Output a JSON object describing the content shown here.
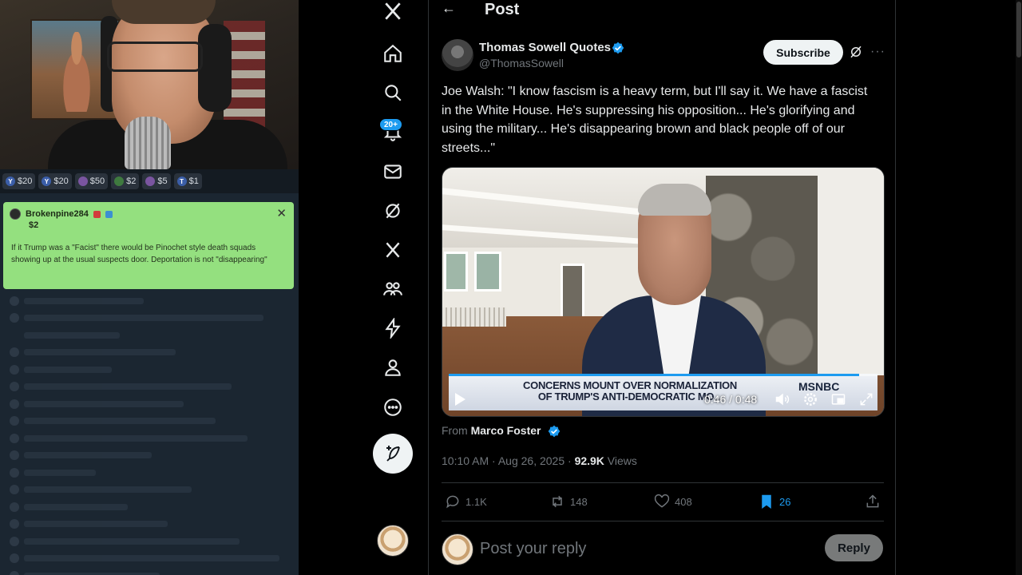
{
  "stream": {
    "tips": [
      {
        "icon": "Y",
        "amount": "$20"
      },
      {
        "icon": "Y",
        "amount": "$20"
      },
      {
        "icon": "",
        "amount": "$50"
      },
      {
        "icon": "",
        "amount": "$2"
      },
      {
        "icon": "",
        "amount": "$5"
      },
      {
        "icon": "T",
        "amount": "$1"
      }
    ],
    "donation": {
      "username": "Brokenpine284",
      "amount": "$2",
      "message": "If it Trump was a \"Facist\" there would be Pinochet style death squads showing up at the usual suspects door. Deportation is not \"disappearing\"",
      "close_label": "✕"
    }
  },
  "nav": {
    "notifications_badge": "20+"
  },
  "header": {
    "back_label": "←",
    "title": "Post"
  },
  "post": {
    "author_name": "Thomas Sowell Quotes",
    "author_handle": "@ThomasSowell",
    "subscribe_label": "Subscribe",
    "more_label": "···",
    "text": "Joe Walsh: \"I know fascism is a heavy term, but I'll say it. We have a fascist in the White House. He's suppressing his opposition... He's glorifying and using the military... He's disappearing brown and black people off of our streets...\"",
    "video": {
      "chyron_line1": "CONCERNS MOUNT OVER NORMALIZATION",
      "chyron_line2": "OF TRUMP'S ANTI-DEMOCRATIC MO...",
      "network": "MSNBC",
      "time_display": "0:46 / 0:48",
      "progress": 0.958
    },
    "from_prefix": "From ",
    "from_name": "Marco Foster",
    "time": "10:10 AM · Aug 26, 2025 · ",
    "views_count": "92.9K",
    "views_label": " Views",
    "actions": {
      "replies": "1.1K",
      "reposts": "148",
      "likes": "408",
      "bookmarks": "26"
    }
  },
  "reply": {
    "placeholder": "Post your reply",
    "button_label": "Reply"
  },
  "colors": {
    "accent": "#1d9bf0",
    "background": "#000000",
    "donation_bg": "#94e07f"
  }
}
